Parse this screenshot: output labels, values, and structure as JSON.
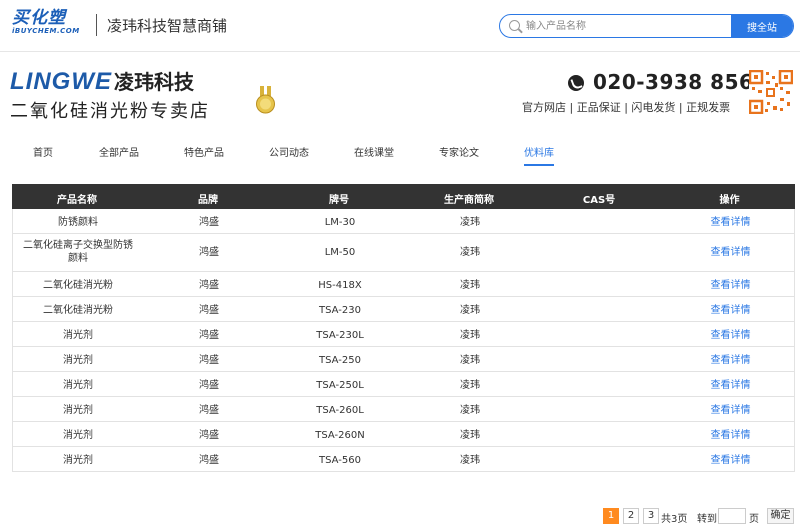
{
  "topbar": {
    "logo_big": "买化塑",
    "logo_small": "iBUYCHEM.COM",
    "shop_title": "凌玮科技智慧商铺",
    "search_placeholder": "输入产品名称",
    "search_button": "搜全站"
  },
  "header": {
    "logo_latin": "LINGWE",
    "logo_cn": "凌玮科技",
    "tagline": "二氧化硅消光粉专卖店",
    "phone": "020-3938 8561",
    "badges": "官方网店 | 正品保证 | 闪电发货 | 正规发票"
  },
  "nav": {
    "items": [
      "首页",
      "全部产品",
      "特色产品",
      "公司动态",
      "在线课堂",
      "专家论文",
      "优料库"
    ],
    "active": "优料库"
  },
  "table": {
    "headers": [
      "产品名称",
      "品牌",
      "牌号",
      "生产商简称",
      "CAS号",
      "操作"
    ],
    "rows": [
      {
        "name": "防锈颜料",
        "brand": "鸿盛",
        "model": "LM-30",
        "maker": "凌玮",
        "cas": "",
        "op": "查看详情"
      },
      {
        "name": "二氧化硅离子交换型防锈颜料",
        "brand": "鸿盛",
        "model": "LM-50",
        "maker": "凌玮",
        "cas": "",
        "op": "查看详情"
      },
      {
        "name": "二氧化硅消光粉",
        "brand": "鸿盛",
        "model": "HS-418X",
        "maker": "凌玮",
        "cas": "",
        "op": "查看详情"
      },
      {
        "name": "二氧化硅消光粉",
        "brand": "鸿盛",
        "model": "TSA-230",
        "maker": "凌玮",
        "cas": "",
        "op": "查看详情"
      },
      {
        "name": "消光剂",
        "brand": "鸿盛",
        "model": "TSA-230L",
        "maker": "凌玮",
        "cas": "",
        "op": "查看详情"
      },
      {
        "name": "消光剂",
        "brand": "鸿盛",
        "model": "TSA-250",
        "maker": "凌玮",
        "cas": "",
        "op": "查看详情"
      },
      {
        "name": "消光剂",
        "brand": "鸿盛",
        "model": "TSA-250L",
        "maker": "凌玮",
        "cas": "",
        "op": "查看详情"
      },
      {
        "name": "消光剂",
        "brand": "鸿盛",
        "model": "TSA-260L",
        "maker": "凌玮",
        "cas": "",
        "op": "查看详情"
      },
      {
        "name": "消光剂",
        "brand": "鸿盛",
        "model": "TSA-260N",
        "maker": "凌玮",
        "cas": "",
        "op": "查看详情"
      },
      {
        "name": "消光剂",
        "brand": "鸿盛",
        "model": "TSA-560",
        "maker": "凌玮",
        "cas": "",
        "op": "查看详情"
      }
    ]
  },
  "pager": {
    "pages": [
      "1",
      "2",
      "3"
    ],
    "current": "1",
    "total": "共3页",
    "goto_label": "转到",
    "page_unit": "页",
    "ok": "确定"
  },
  "colors": {
    "accent": "#2b78e4",
    "pager_active": "#ff8a1f",
    "table_header": "#333333",
    "brand_blue": "#1d5aa8"
  }
}
